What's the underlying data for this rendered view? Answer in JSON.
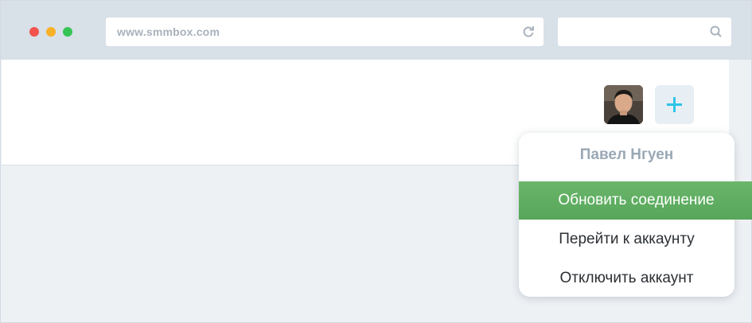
{
  "browser": {
    "url": "www.smmbox.com",
    "search_value": "",
    "reload_icon": "reload-icon",
    "search_icon": "search-icon"
  },
  "toolbar": {
    "add_button_icon": "plus-icon",
    "accent_color": "#2fc4e8"
  },
  "account_menu": {
    "user_name": "Павел Нгуен",
    "items": [
      {
        "label": "Обновить соединение",
        "active": true
      },
      {
        "label": "Перейти к аккаунту",
        "active": false
      },
      {
        "label": "Отключить аккаунт",
        "active": false
      }
    ],
    "active_color": "#5fae60"
  }
}
